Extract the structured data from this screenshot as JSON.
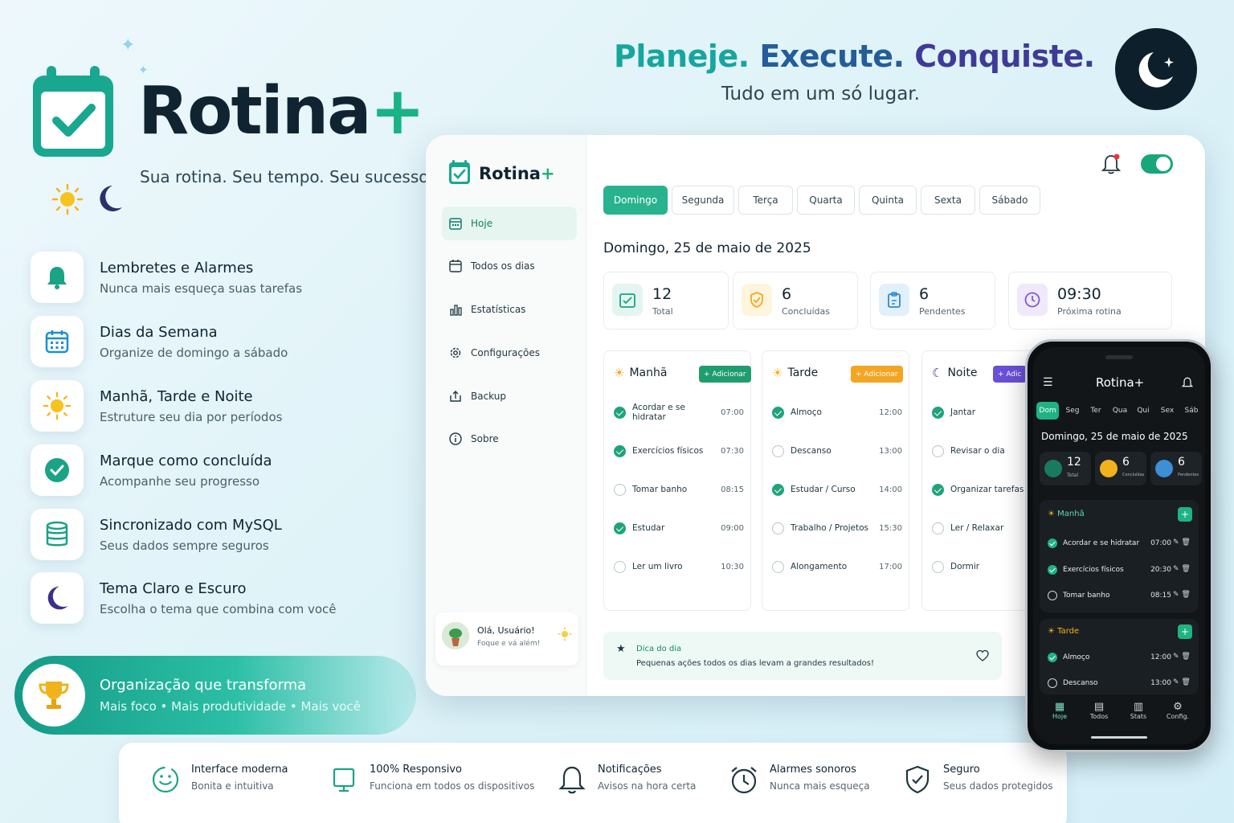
{
  "brand": {
    "name": "Rotina",
    "plus": "+",
    "tagline": "Sua rotina. Seu tempo. Seu sucesso."
  },
  "headline": {
    "part1": "Planeje.",
    "part2": "Execute.",
    "part3": "Conquiste.",
    "sub": "Tudo em um só lugar."
  },
  "features": [
    {
      "title": "Lembretes e Alarmes",
      "desc": "Nunca mais esqueça suas tarefas",
      "icon": "bell-icon"
    },
    {
      "title": "Dias da Semana",
      "desc": "Organize de domingo a sábado",
      "icon": "calendar-icon"
    },
    {
      "title": "Manhã, Tarde e Noite",
      "desc": "Estruture seu dia por períodos",
      "icon": "sun-icon"
    },
    {
      "title": "Marque como concluída",
      "desc": "Acompanhe seu progresso",
      "icon": "check-circle-icon"
    },
    {
      "title": "Sincronizado com MySQL",
      "desc": "Seus dados sempre seguros",
      "icon": "database-icon"
    },
    {
      "title": "Tema Claro e Escuro",
      "desc": "Escolha o tema que combina com você",
      "icon": "moon-icon"
    }
  ],
  "banner": {
    "title": "Organização que transforma",
    "sub": "Mais foco • Mais produtividade • Mais você"
  },
  "bottom_features": [
    {
      "title": "Interface moderna",
      "desc": "Bonita e intuitiva"
    },
    {
      "title": "100% Responsivo",
      "desc": "Funciona em todos os dispositivos"
    },
    {
      "title": "Notificações",
      "desc": "Avisos na hora certa"
    },
    {
      "title": "Alarmes sonoros",
      "desc": "Nunca mais esqueça"
    },
    {
      "title": "Seguro",
      "desc": "Seus dados protegidos"
    }
  ],
  "app": {
    "brand": "Rotina",
    "plus": "+",
    "nav": [
      "Hoje",
      "Todos os dias",
      "Estatísticas",
      "Configurações",
      "Backup",
      "Sobre"
    ],
    "user": {
      "greeting": "Olá, Usuário!",
      "sub": "Foque e vá além!"
    },
    "days": [
      "Domingo",
      "Segunda",
      "Terça",
      "Quarta",
      "Quinta",
      "Sexta",
      "Sábado"
    ],
    "date": "Domingo, 25 de maio de 2025",
    "stats": [
      {
        "value": "12",
        "label": "Total"
      },
      {
        "value": "6",
        "label": "Concluídas"
      },
      {
        "value": "6",
        "label": "Pendentes"
      },
      {
        "value": "09:30",
        "label": "Próxima rotina"
      }
    ],
    "add_label": "+ Adicionar",
    "add_label_short": "+ Adic",
    "periods": [
      {
        "name": "Manhã",
        "tasks": [
          {
            "name": "Acordar e se hidratar",
            "time": "07:00",
            "done": true
          },
          {
            "name": "Exercícios físicos",
            "time": "07:30",
            "done": true
          },
          {
            "name": "Tomar banho",
            "time": "08:15",
            "done": false
          },
          {
            "name": "Estudar",
            "time": "09:00",
            "done": true
          },
          {
            "name": "Ler um livro",
            "time": "10:30",
            "done": false
          }
        ]
      },
      {
        "name": "Tarde",
        "tasks": [
          {
            "name": "Almoço",
            "time": "12:00",
            "done": true
          },
          {
            "name": "Descanso",
            "time": "13:00",
            "done": false
          },
          {
            "name": "Estudar / Curso",
            "time": "14:00",
            "done": true
          },
          {
            "name": "Trabalho / Projetos",
            "time": "15:30",
            "done": false
          },
          {
            "name": "Alongamento",
            "time": "17:00",
            "done": false
          }
        ]
      },
      {
        "name": "Noite",
        "tasks": [
          {
            "name": "Jantar",
            "time": "",
            "done": true
          },
          {
            "name": "Revisar o dia",
            "time": "",
            "done": false
          },
          {
            "name": "Organizar tarefas",
            "time": "",
            "done": true
          },
          {
            "name": "Ler / Relaxar",
            "time": "",
            "done": false
          },
          {
            "name": "Dormir",
            "time": "",
            "done": false
          }
        ]
      }
    ],
    "tip": {
      "title": "Dica do dia",
      "text": "Pequenas ações todos os dias levam a grandes resultados!"
    }
  },
  "phone": {
    "title": "Rotina+",
    "days": [
      "Dom",
      "Seg",
      "Ter",
      "Qua",
      "Qui",
      "Sex",
      "Sáb"
    ],
    "date": "Domingo, 25 de maio de 2025",
    "stats": [
      {
        "value": "12",
        "label": "Total"
      },
      {
        "value": "6",
        "label": "Concluídas"
      },
      {
        "value": "6",
        "label": "Pendentes"
      }
    ],
    "sections": [
      {
        "name": "Manhã",
        "tasks": [
          {
            "name": "Acordar e se hidratar",
            "time": "07:00",
            "done": true
          },
          {
            "name": "Exercícios físicos",
            "time": "20:30",
            "done": true
          },
          {
            "name": "Tomar banho",
            "time": "08:15",
            "done": false
          }
        ]
      },
      {
        "name": "Tarde",
        "tasks": [
          {
            "name": "Almoço",
            "time": "12:00",
            "done": true
          },
          {
            "name": "Descanso",
            "time": "13:00",
            "done": false
          }
        ]
      }
    ],
    "nav": [
      "Hoje",
      "Todos",
      "Stats",
      "Config."
    ]
  },
  "colors": {
    "accent": "#19b386",
    "dark": "#0f2430",
    "morning": "#1f9d6e",
    "afternoon": "#f5a524",
    "night": "#6a4fd8"
  }
}
